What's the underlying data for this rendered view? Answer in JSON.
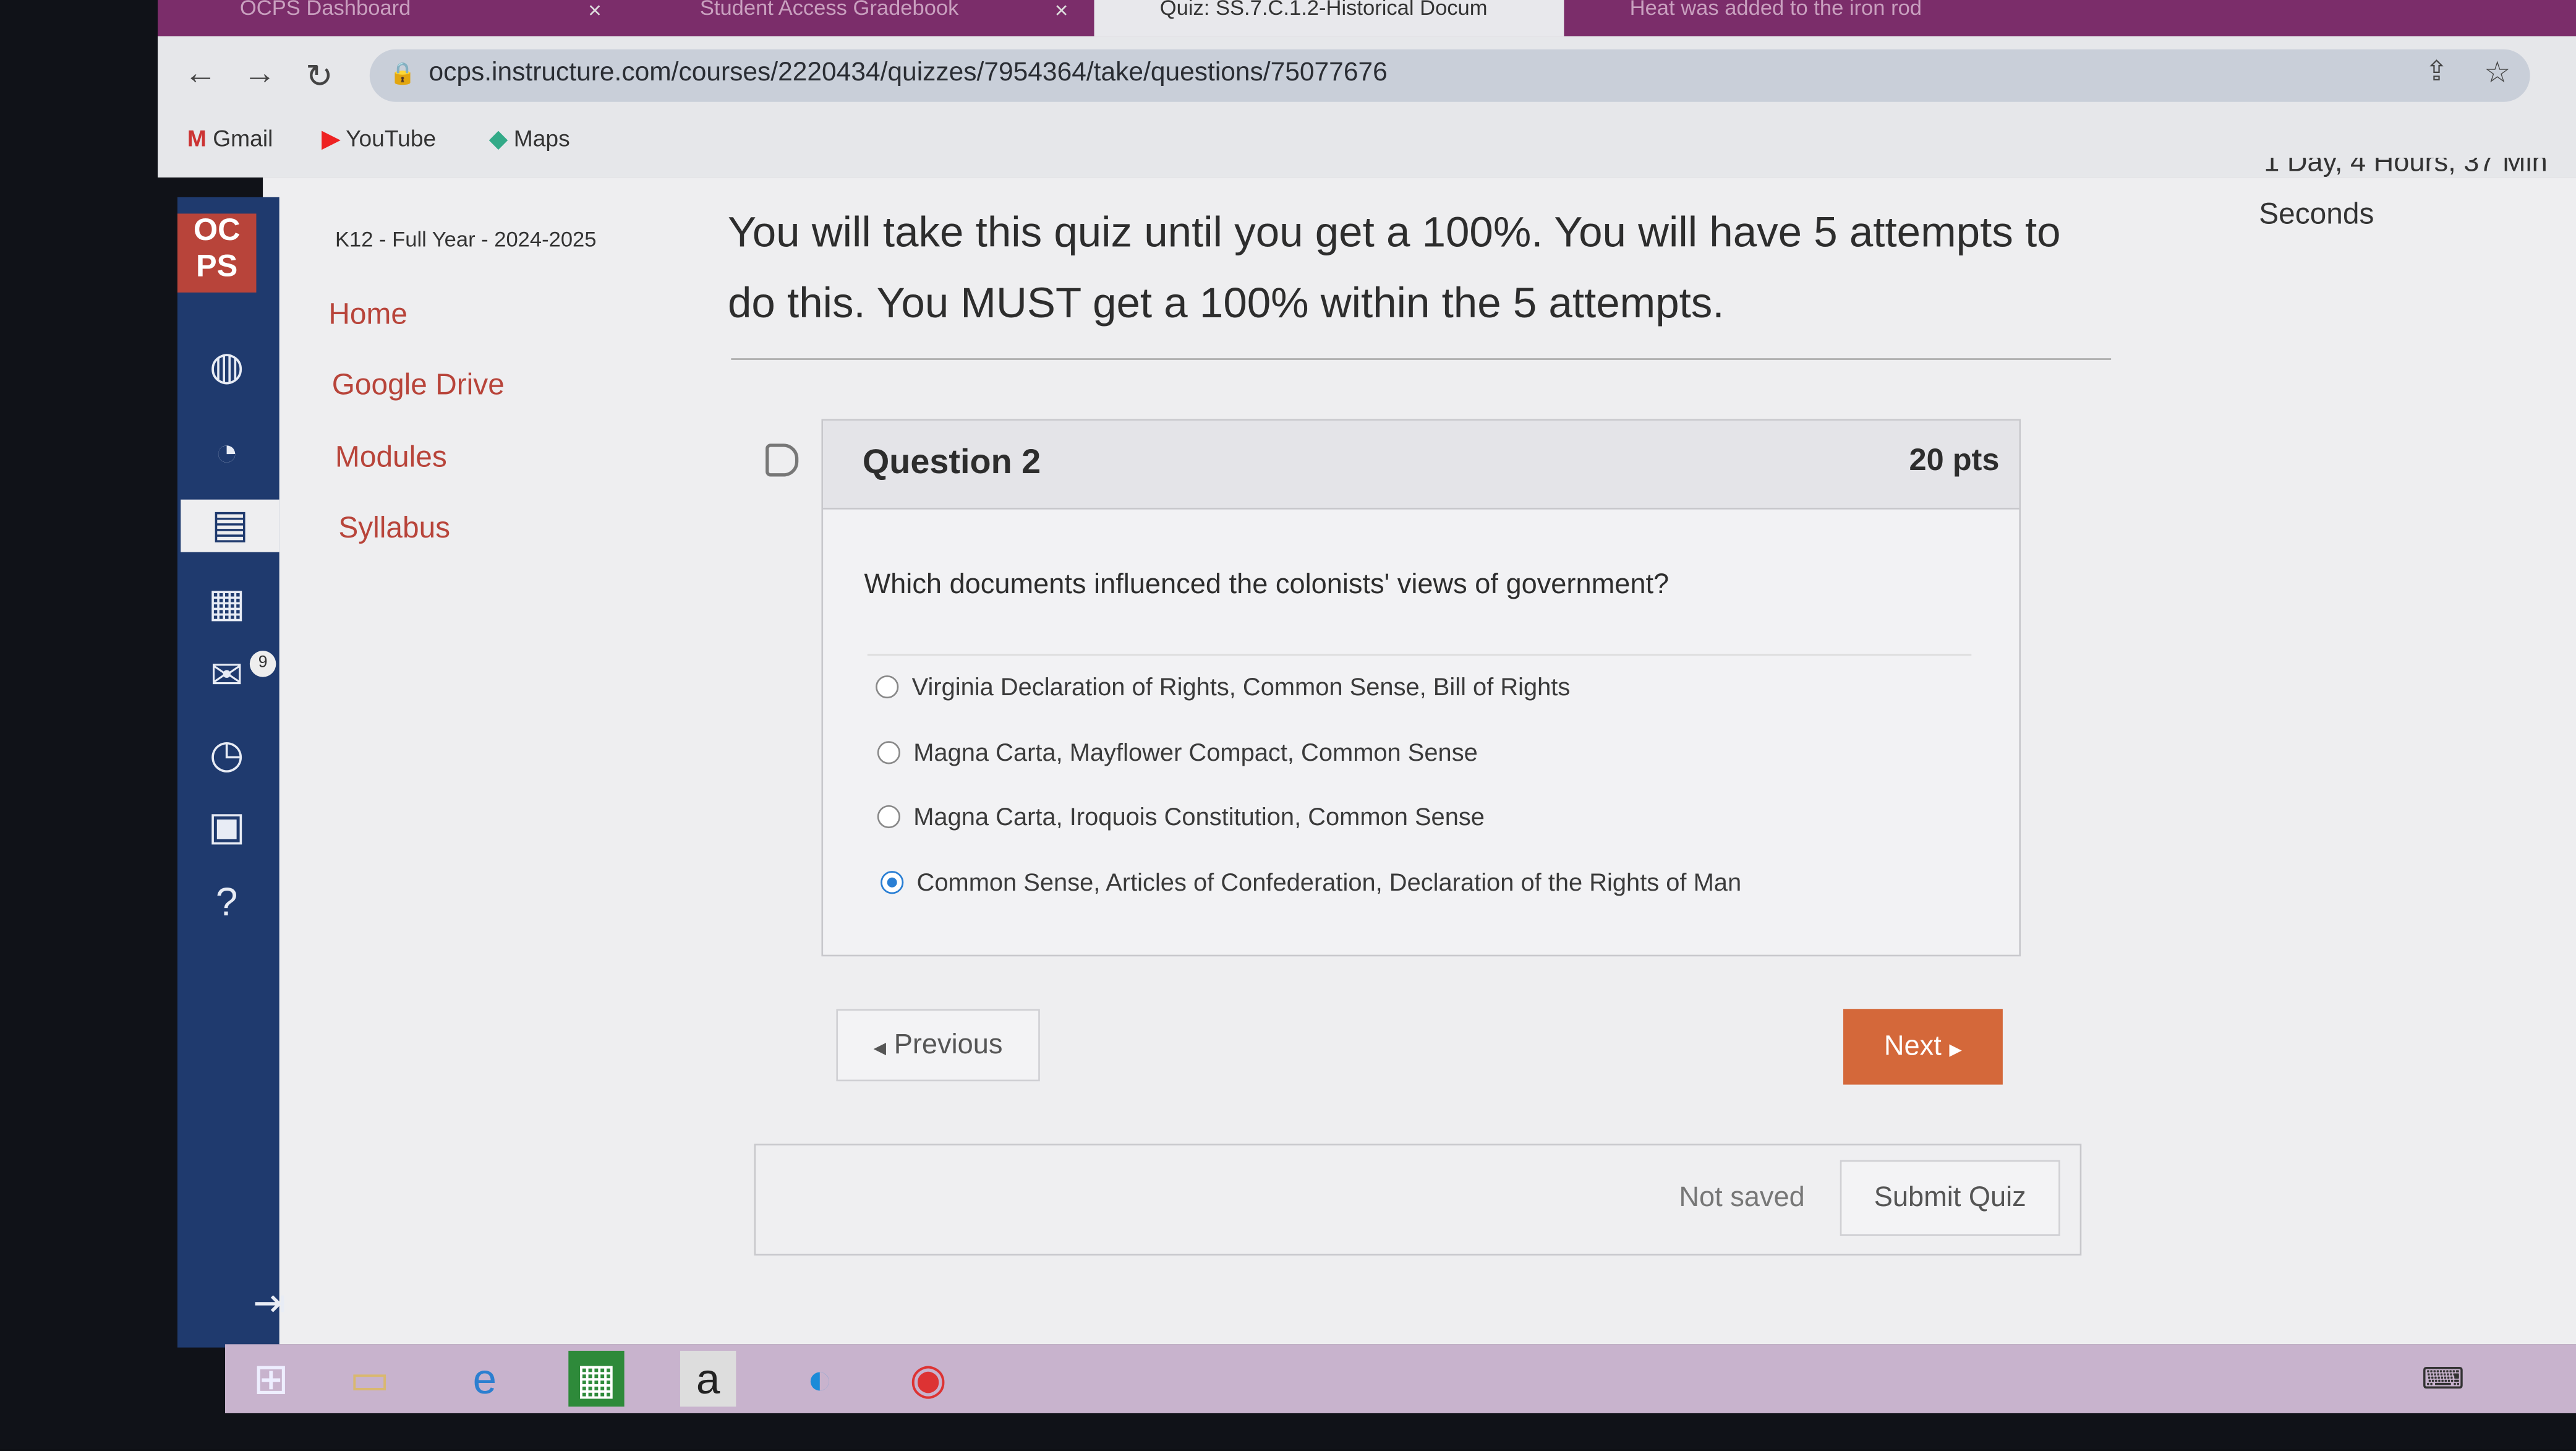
{
  "browser": {
    "tabs": [
      {
        "label": "OCPS Dashboard",
        "active": false
      },
      {
        "label": "Student Access Gradebook",
        "active": false
      },
      {
        "label": "Quiz: SS.7.C.1.2-Historical Docum",
        "active": true
      },
      {
        "label": "Heat was added to the iron rod",
        "active": false
      }
    ],
    "url": "ocps.instructure.com/courses/2220434/quizzes/7954364/take/questions/75077676",
    "bookmarks": [
      "Gmail",
      "YouTube",
      "Maps"
    ],
    "theme_color": "#7b2d6a"
  },
  "course": {
    "term": "K12 - Full Year - 2024-2025",
    "nav": [
      "Home",
      "Google Drive",
      "Modules",
      "Syllabus"
    ]
  },
  "global_nav": {
    "logo": "OCPS",
    "inbox_badge": "9",
    "color": "#1f3a6e"
  },
  "timer": {
    "partial": "1 Day, 4 Hours, 37 Min",
    "seconds_label": "Seconds"
  },
  "quiz": {
    "instructions": "You will take this quiz until you get a 100%.  You will have 5 attempts to do this. You MUST get a 100% within the 5 attempts.",
    "question_title": "Question 2",
    "points": "20 pts",
    "question_text": "Which documents influenced the colonists' views of government?",
    "options": [
      {
        "label": "Virginia Declaration of Rights, Common Sense, Bill of Rights",
        "selected": false
      },
      {
        "label": "Magna Carta, Mayflower Compact, Common Sense",
        "selected": false
      },
      {
        "label": "Magna Carta, Iroquois Constitution, Common Sense",
        "selected": false
      },
      {
        "label": "Common Sense, Articles of Confederation, Declaration of the Rights of Man",
        "selected": true
      }
    ],
    "previous_label": "Previous",
    "next_label": "Next",
    "save_status": "Not saved",
    "submit_label": "Submit Quiz",
    "accent": "#d4683a"
  }
}
